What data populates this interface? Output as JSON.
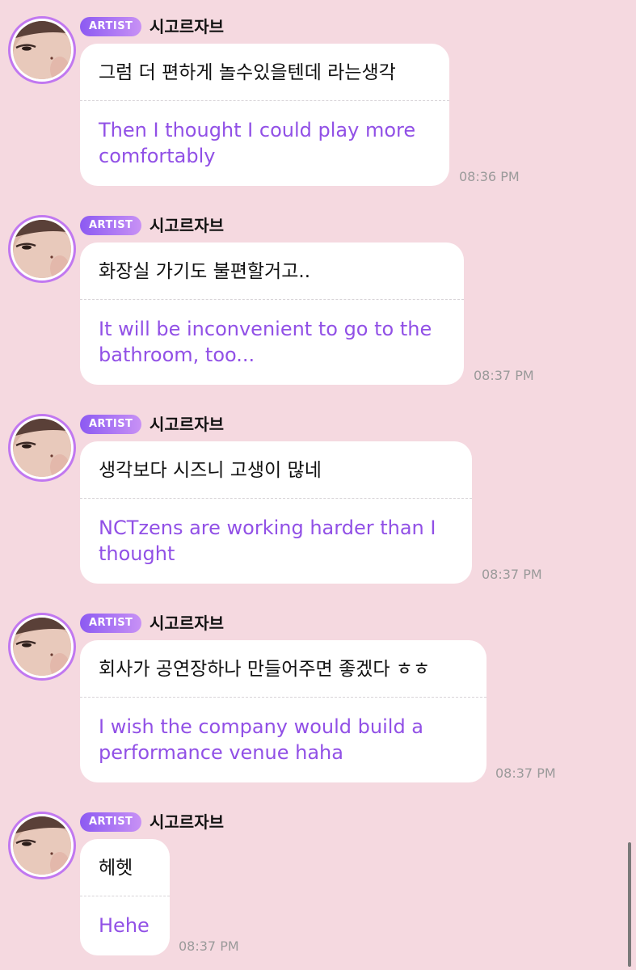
{
  "messages": [
    {
      "badge": "ARTIST",
      "name": "시고르자브",
      "original": "그럼 더 편하게 놀수있을텐데 라는생각",
      "translation": "Then I thought I could play more comfortably",
      "time": "08:36 PM"
    },
    {
      "badge": "ARTIST",
      "name": "시고르자브",
      "original": "화장실 가기도 불편할거고..",
      "translation": "It will be inconvenient to go to the bathroom, too...",
      "time": "08:37 PM"
    },
    {
      "badge": "ARTIST",
      "name": "시고르자브",
      "original": "생각보다 시즈니 고생이 많네",
      "translation": "NCTzens are working harder than I thought",
      "time": "08:37 PM"
    },
    {
      "badge": "ARTIST",
      "name": "시고르자브",
      "original": "회사가 공연장하나 만들어주면 좋겠다 ㅎㅎ",
      "translation": "I wish the company would build a performance venue haha",
      "time": "08:37 PM"
    },
    {
      "badge": "ARTIST",
      "name": "시고르자브",
      "original": "헤헷",
      "translation": "Hehe",
      "time": "08:37 PM"
    }
  ],
  "colors": {
    "background": "#f5d9e0",
    "badge_gradient_start": "#8c5af2",
    "badge_gradient_end": "#c891f5",
    "avatar_ring": "#c178f0",
    "translation_text": "#9150e6",
    "timestamp_text": "#9a9a9a"
  },
  "icons": {
    "avatar": "profile-photo-avatar"
  }
}
